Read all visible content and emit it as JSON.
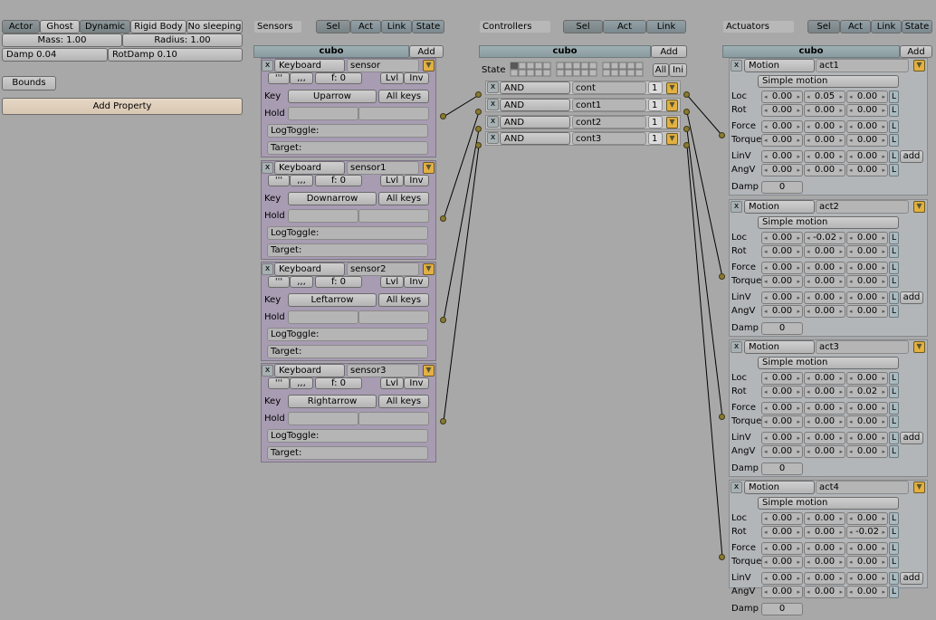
{
  "physics": {
    "toggles": [
      "Actor",
      "Ghost",
      "Dynamic",
      "Rigid Body",
      "No sleeping"
    ],
    "mass": "Mass: 1.00",
    "radius": "Radius: 1.00",
    "damp": "Damp 0.04",
    "rotdamp": "RotDamp 0.10",
    "bounds": "Bounds",
    "add_property": "Add Property"
  },
  "sensors": {
    "title": "Sensors",
    "tabs": [
      "Sel",
      "Act",
      "Link",
      "State"
    ],
    "object": "cubo",
    "add": "Add",
    "items": [
      {
        "type": "Keyboard",
        "name": "sensor",
        "freq": "f: 0",
        "key": "Uparrow"
      },
      {
        "type": "Keyboard",
        "name": "sensor1",
        "freq": "f: 0",
        "key": "Downarrow"
      },
      {
        "type": "Keyboard",
        "name": "sensor2",
        "freq": "f: 0",
        "key": "Leftarrow"
      },
      {
        "type": "Keyboard",
        "name": "sensor3",
        "freq": "f: 0",
        "key": "Rightarrow"
      }
    ],
    "labels": {
      "key": "Key",
      "hold": "Hold",
      "allkeys": "All keys",
      "logtoggle": "LogToggle:",
      "target": "Target:",
      "lvl": "Lvl",
      "inv": "Inv",
      "pulse1": "'''",
      "pulse2": ",,,"
    }
  },
  "controllers": {
    "title": "Controllers",
    "tabs": [
      "Sel",
      "Act",
      "Link"
    ],
    "object": "cubo",
    "add": "Add",
    "state_label": "State",
    "all": "All",
    "ini": "Ini",
    "items": [
      {
        "type": "AND",
        "name": "cont",
        "state": "1"
      },
      {
        "type": "AND",
        "name": "cont1",
        "state": "1"
      },
      {
        "type": "AND",
        "name": "cont2",
        "state": "1"
      },
      {
        "type": "AND",
        "name": "cont3",
        "state": "1"
      }
    ]
  },
  "actuators": {
    "title": "Actuators",
    "tabs": [
      "Sel",
      "Act",
      "Link",
      "State"
    ],
    "object": "cubo",
    "add": "Add",
    "labels": {
      "mode": "Simple motion",
      "loc": "Loc",
      "rot": "Rot",
      "force": "Force",
      "torque": "Torque",
      "linv": "LinV",
      "angv": "AngV",
      "damp": "Damp",
      "L": "L",
      "addbtn": "add"
    },
    "items": [
      {
        "type": "Motion",
        "name": "act1",
        "loc": [
          "0.00",
          "0.05",
          "0.00"
        ],
        "rot": [
          "0.00",
          "0.00",
          "0.00"
        ],
        "force": [
          "0.00",
          "0.00",
          "0.00"
        ],
        "torque": [
          "0.00",
          "0.00",
          "0.00"
        ],
        "linv": [
          "0.00",
          "0.00",
          "0.00"
        ],
        "angv": [
          "0.00",
          "0.00",
          "0.00"
        ],
        "damp": "0"
      },
      {
        "type": "Motion",
        "name": "act2",
        "loc": [
          "0.00",
          "-0.02",
          "0.00"
        ],
        "rot": [
          "0.00",
          "0.00",
          "0.00"
        ],
        "force": [
          "0.00",
          "0.00",
          "0.00"
        ],
        "torque": [
          "0.00",
          "0.00",
          "0.00"
        ],
        "linv": [
          "0.00",
          "0.00",
          "0.00"
        ],
        "angv": [
          "0.00",
          "0.00",
          "0.00"
        ],
        "damp": "0"
      },
      {
        "type": "Motion",
        "name": "act3",
        "loc": [
          "0.00",
          "0.00",
          "0.00"
        ],
        "rot": [
          "0.00",
          "0.00",
          "0.02"
        ],
        "force": [
          "0.00",
          "0.00",
          "0.00"
        ],
        "torque": [
          "0.00",
          "0.00",
          "0.00"
        ],
        "linv": [
          "0.00",
          "0.00",
          "0.00"
        ],
        "angv": [
          "0.00",
          "0.00",
          "0.00"
        ],
        "damp": "0"
      },
      {
        "type": "Motion",
        "name": "act4",
        "loc": [
          "0.00",
          "0.00",
          "0.00"
        ],
        "rot": [
          "0.00",
          "0.00",
          "-0.02"
        ],
        "force": [
          "0.00",
          "0.00",
          "0.00"
        ],
        "torque": [
          "0.00",
          "0.00",
          "0.00"
        ],
        "linv": [
          "0.00",
          "0.00",
          "0.00"
        ],
        "angv": [
          "0.00",
          "0.00",
          "0.00"
        ],
        "damp": "0"
      }
    ]
  },
  "colors": {
    "sensor_panel": "#a79cb2",
    "actuator_panel": "#b3b6b9",
    "header": "#8a9ba0",
    "link_dot": "#8a7a30",
    "background": "#a8a8a8"
  }
}
